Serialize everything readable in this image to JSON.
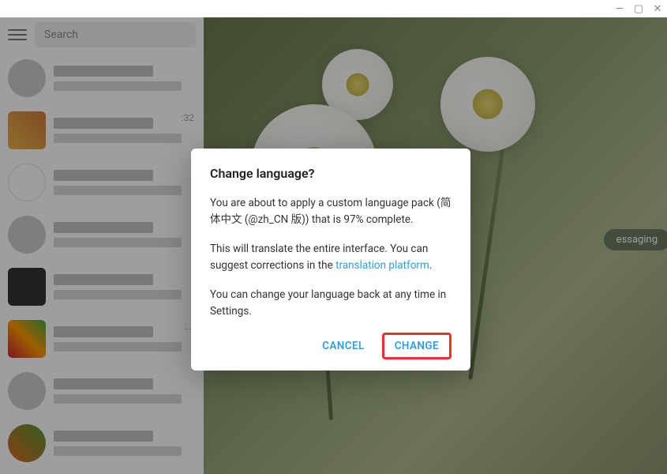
{
  "window": {
    "minimize": "—",
    "maximize": "▢",
    "close": "✕"
  },
  "sidebar": {
    "search_placeholder": "Search",
    "chats": [
      {
        "time": ""
      },
      {
        "time": ":32"
      },
      {
        "time": ""
      },
      {
        "time": ""
      },
      {
        "time": ""
      },
      {
        "time": ":..."
      },
      {
        "time": ""
      },
      {
        "time": ""
      }
    ]
  },
  "main": {
    "status_badge": "essaging"
  },
  "dialog": {
    "title": "Change language?",
    "body_p1_a": "You are about to apply a custom language pack (",
    "body_p1_b": "简体中文 (@zh_CN 版)",
    "body_p1_c": ") that is 97% complete.",
    "body_p2_a": "This will translate the entire interface. You can suggest corrections in the ",
    "body_p2_link": "translation platform",
    "body_p2_b": ".",
    "body_p3": "You can change your language back at any time in Settings.",
    "cancel_label": "CANCEL",
    "change_label": "CHANGE"
  }
}
